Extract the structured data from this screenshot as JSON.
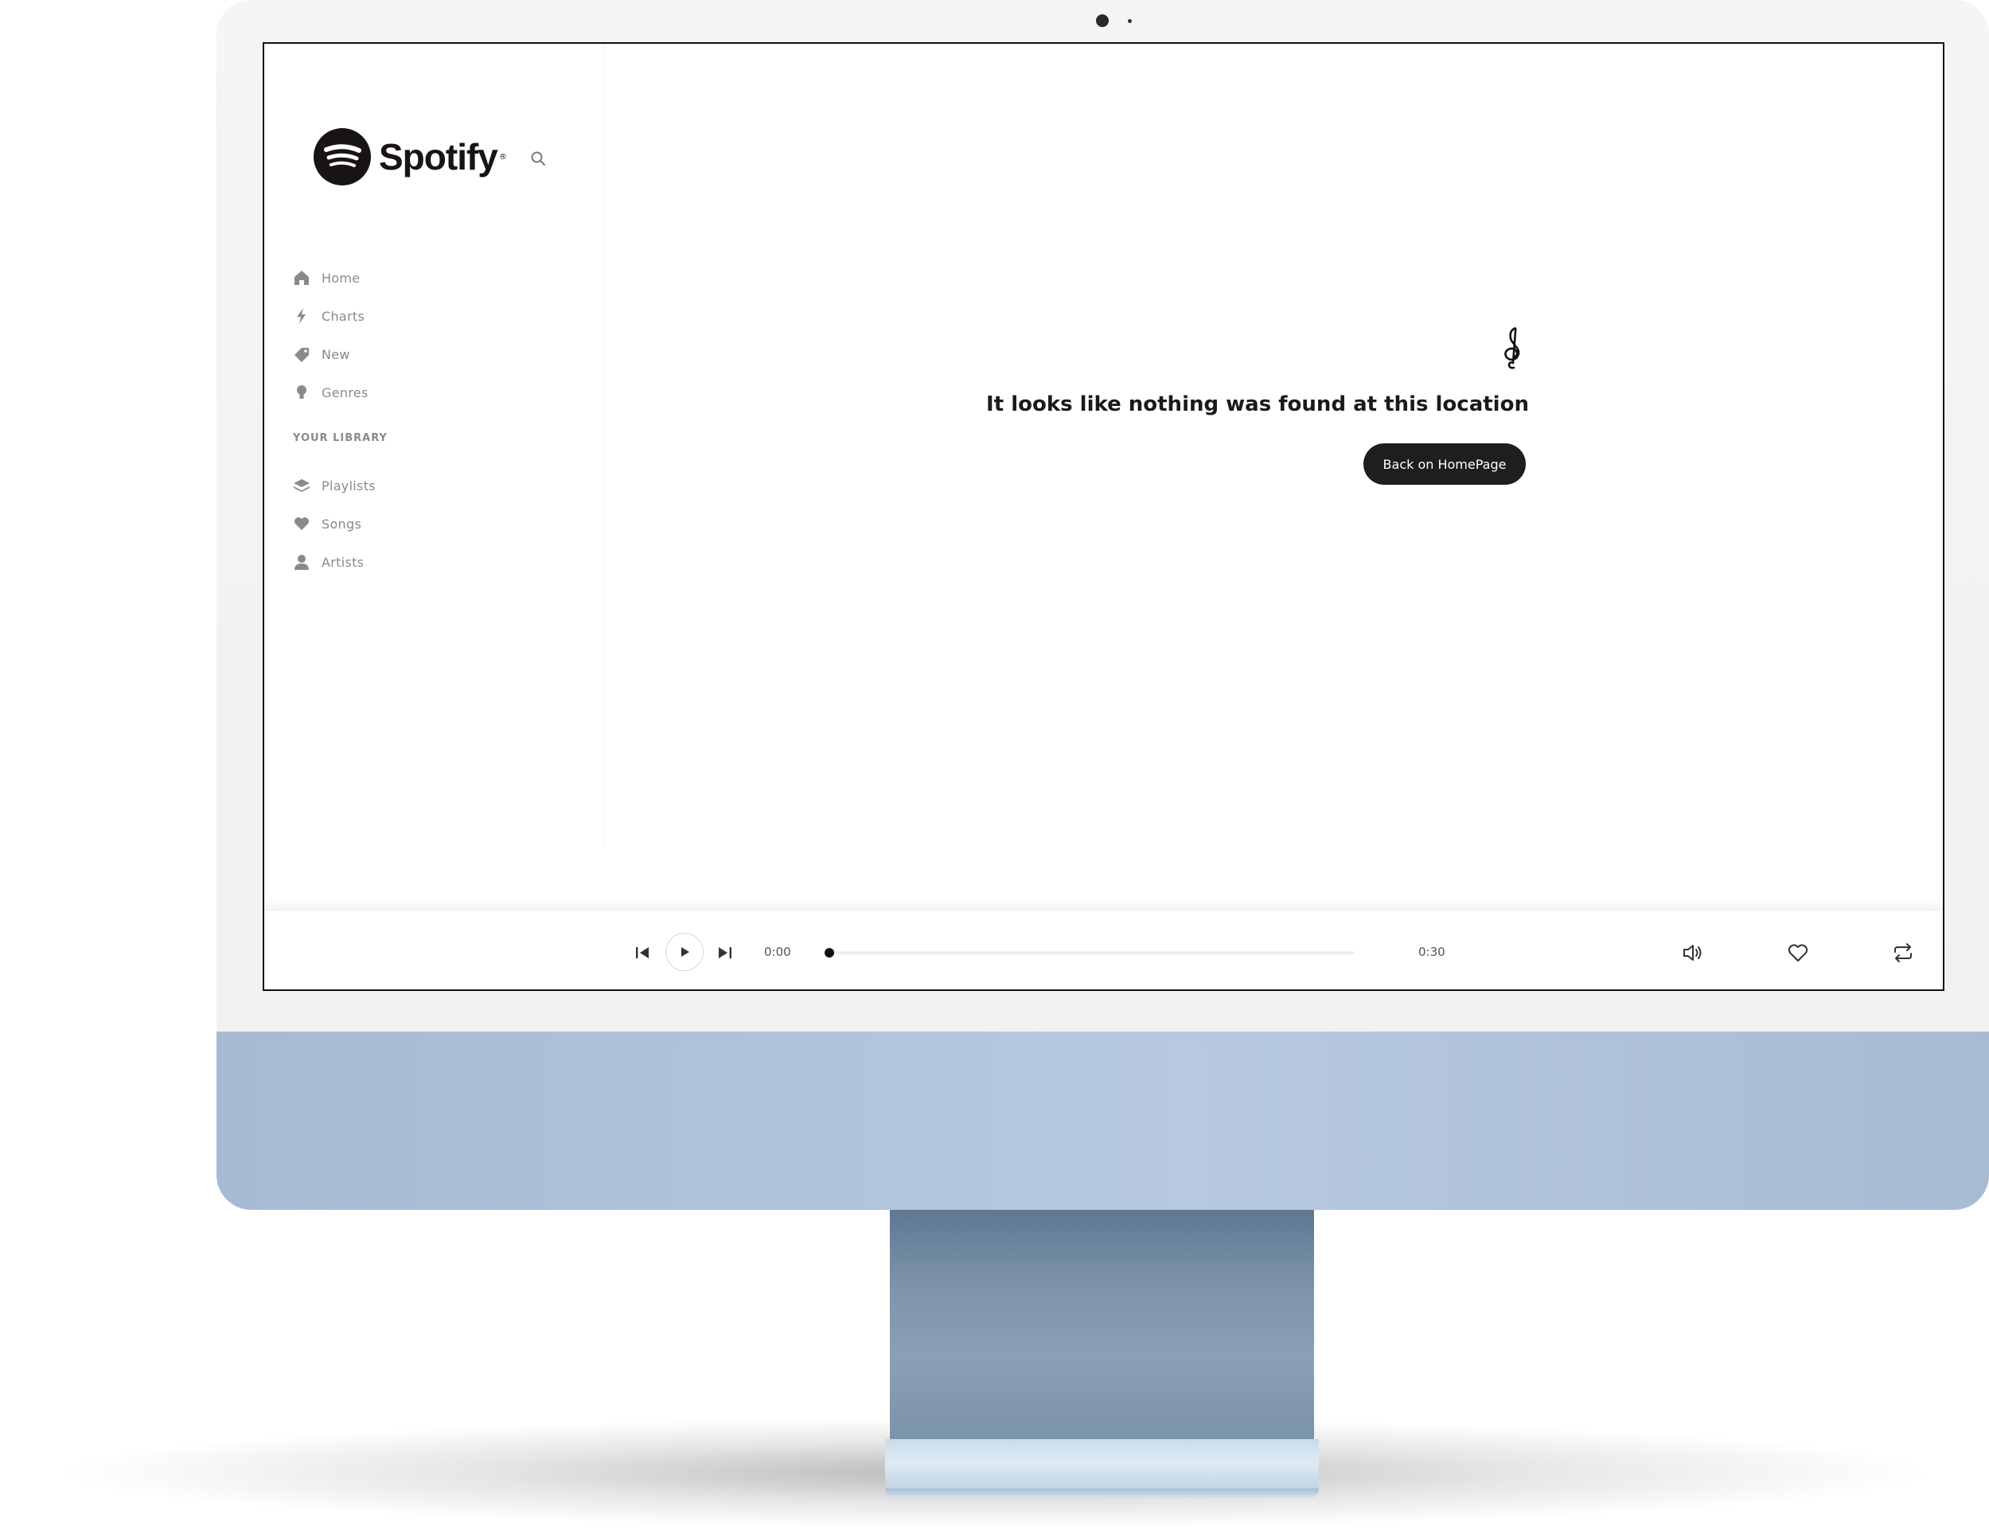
{
  "app": {
    "brand": "Spotify"
  },
  "sidebar": {
    "nav": [
      {
        "label": "Home",
        "icon": "home-icon"
      },
      {
        "label": "Charts",
        "icon": "lightning-icon"
      },
      {
        "label": "New",
        "icon": "tag-icon"
      },
      {
        "label": "Genres",
        "icon": "lightbulb-icon"
      }
    ],
    "library_heading": "YOUR LIBRARY",
    "library": [
      {
        "label": "Playlists",
        "icon": "layers-icon"
      },
      {
        "label": "Songs",
        "icon": "heart-icon"
      },
      {
        "label": "Artists",
        "icon": "user-icon"
      }
    ]
  },
  "main": {
    "message": "It looks like nothing was found at this location",
    "home_button_label": "Back on HomePage",
    "icon": "treble-clef-icon"
  },
  "player": {
    "current_time": "0:00",
    "total_time": "0:30",
    "progress": 0,
    "icons": [
      "skip-back-icon",
      "play-icon",
      "skip-forward-icon",
      "volume-icon",
      "heart-icon",
      "repeat-icon"
    ]
  },
  "colors": {
    "text_dark": "#1a1a1a",
    "text_muted": "#8a8a8a",
    "button_dark": "#1e1e1e",
    "chin_blue": "#b3c7de",
    "stand_blue": "#8aa0b6"
  }
}
